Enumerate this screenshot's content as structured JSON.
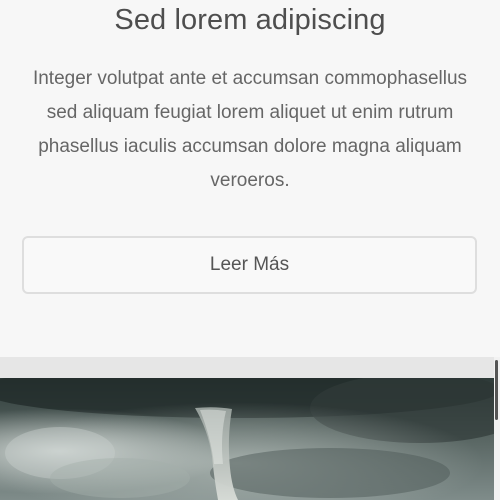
{
  "section": {
    "heading": "Sed lorem adipiscing",
    "paragraph": "Integer volutpat ante et accumsan commophasellus sed aliquam feugiat lorem aliquet ut enim rutrum phasellus iaculis accumsan dolore magna aliquam veroeros.",
    "button_label": "Leer Más"
  },
  "image": {
    "subject": "tornado-storm-photo"
  }
}
